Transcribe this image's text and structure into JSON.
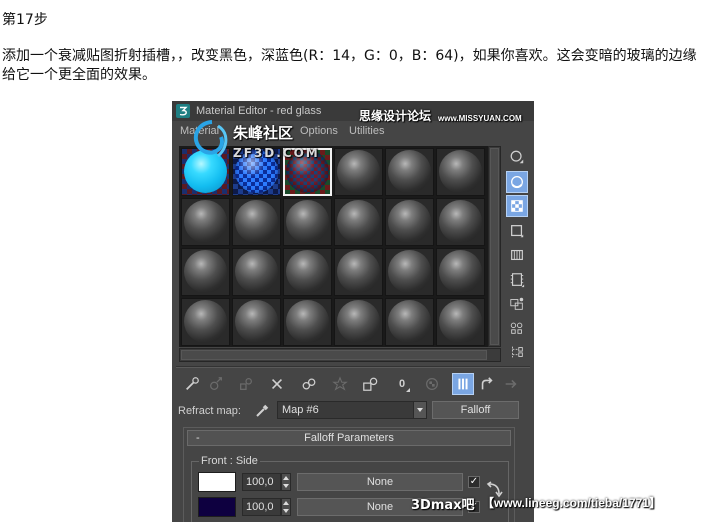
{
  "page": {
    "step_title": "第17步",
    "paragraph_lines": [
      "添加一个衰减贴图折射插槽，，改变黑色，深蓝色(R：14，G：0，B：64)，如果你喜欢。这会变暗的玻璃的边缘",
      "给它一个更全面的效果。"
    ]
  },
  "material_editor": {
    "title": "Material Editor - red glass",
    "app_icon": "3dsmax-icon",
    "menu": [
      "Material",
      "Options",
      "Utilities"
    ],
    "side_toolbar": [
      {
        "icon": "sample-type-icon",
        "active": false
      },
      {
        "icon": "backlight-icon",
        "active": true
      },
      {
        "icon": "background-checker-icon",
        "active": true
      },
      {
        "icon": "sample-uv-tiling-icon",
        "active": false
      },
      {
        "icon": "video-color-check-icon",
        "active": false
      },
      {
        "icon": "make-preview-icon",
        "active": false
      },
      {
        "icon": "options-icon",
        "active": false
      },
      {
        "icon": "select-by-material-icon",
        "active": false
      },
      {
        "icon": "material-map-navigator-icon",
        "active": false
      }
    ],
    "bottom_toolbar": [
      {
        "icon": "get-material-icon",
        "enabled": true,
        "active": false
      },
      {
        "icon": "put-to-scene-icon",
        "enabled": false,
        "active": false
      },
      {
        "icon": "assign-to-selection-icon",
        "enabled": false,
        "active": false
      },
      {
        "icon": "reset-map-icon",
        "enabled": true,
        "active": false
      },
      {
        "icon": "make-copy-icon",
        "enabled": true,
        "active": false
      },
      {
        "icon": "make-unique-icon",
        "enabled": false,
        "active": false
      },
      {
        "icon": "put-to-library-icon",
        "enabled": true,
        "active": false
      },
      {
        "icon": "material-id-channel-icon",
        "enabled": true,
        "active": false
      },
      {
        "icon": "show-map-in-viewport-icon",
        "enabled": false,
        "active": false
      },
      {
        "icon": "show-end-result-icon",
        "enabled": true,
        "active": true
      },
      {
        "icon": "go-to-parent-icon",
        "enabled": true,
        "active": false
      },
      {
        "icon": "go-forward-to-sibling-icon",
        "enabled": false,
        "active": false
      }
    ],
    "material_id_channel": "0",
    "map_slot": {
      "label": "Refract map:",
      "map_name": "Map #6",
      "map_type": "Falloff"
    },
    "rollout": {
      "collapse_symbol": "-",
      "title": "Falloff Parameters",
      "group_label": "Front : Side",
      "rows": [
        {
          "color": "#ffffff",
          "amount": "100,0",
          "map": "None",
          "enabled": true
        },
        {
          "color": "#0e0040",
          "amount": "100,0",
          "map": "None",
          "enabled": true
        }
      ]
    }
  },
  "watermarks": {
    "forum_name": "思缘设计论坛",
    "forum_url": "www.MISSYUAN.COM",
    "community_name": "朱峰社区",
    "community_url": "ZF3D.COM",
    "tieba_name": "3Dmax吧",
    "tieba_url": "【www.lineeg.com/tieba/1771】"
  },
  "colors": {
    "editor_background": "#454545",
    "active_button": "#7aa6e3",
    "selected_slot_border": "#f2f2f2"
  }
}
